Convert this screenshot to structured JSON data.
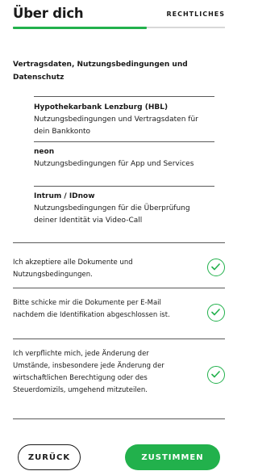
{
  "header": {
    "title": "Über dich",
    "link_label": "RECHTLICHES",
    "progress": 0.63
  },
  "section": {
    "title": "Vertragsdaten, Nutzungsbedingungen und Datenschutz"
  },
  "documents": [
    {
      "name": "Hypothekarbank Lenzburg (HBL)",
      "description": "Nutzungsbedingungen und Vertragsdaten für dein Bankkonto"
    },
    {
      "name": "neon",
      "description": "Nutzungsbedingungen für App und Services"
    },
    {
      "name": "Intrum / IDnow",
      "description": "Nutzungsbedingungen für die Überprüfung deiner Identität via Video-Call"
    }
  ],
  "consents": [
    {
      "text": "Ich akzeptiere alle Dokumente und Nutzungsbedingungen.",
      "checked": true
    },
    {
      "text": "Bitte schicke mir die Dokumente per E-Mail nachdem die Identifikation abgeschlossen ist.",
      "checked": true
    },
    {
      "text": "Ich verpflichte mich, jede Änderung der Umstände, insbesondere jede Änderung der wirtschaftlichen Berechtigung oder des Steuerdomizils, umgehend mitzuteilen.",
      "checked": true
    }
  ],
  "buttons": {
    "back_label": "ZURÜCK",
    "accept_label": "ZUSTIMMEN"
  },
  "colors": {
    "accent": "#22b14c",
    "text": "#1a1a1a",
    "rule": "#5a5a5a"
  }
}
